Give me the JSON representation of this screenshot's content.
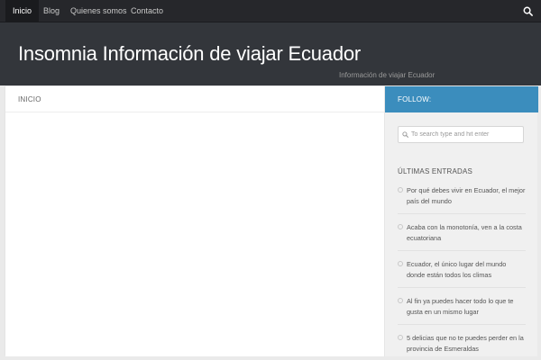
{
  "nav": {
    "items": [
      "Inicio",
      "Blog",
      "Quienes somos",
      "Contacto"
    ],
    "search_icon": "search-icon"
  },
  "header": {
    "title": "Insomnia Información de viajar Ecuador",
    "description": "Información de viajar Ecuador"
  },
  "main": {
    "breadcrumb": "INICIO"
  },
  "sidebar": {
    "follow_label": "FOLLOW:",
    "search_placeholder": "To search type and hit enter",
    "widget_title": "ÚLTIMAS ENTRADAS",
    "posts": [
      "Por qué debes vivir en Ecuador, el mejor país del mundo",
      "Acaba con la monotonía, ven a la costa ecuatoriana",
      "Ecuador, el único lugar del mundo donde están todos los climas",
      "Al fin ya puedes hacer todo lo que te gusta en un mismo lugar",
      "5 delicias que no te puedes perder en la provincia de Esmeraldas"
    ]
  },
  "colors": {
    "nav_bg": "#26272b",
    "header_bg": "#33363b",
    "accent": "#3b8dbd"
  }
}
